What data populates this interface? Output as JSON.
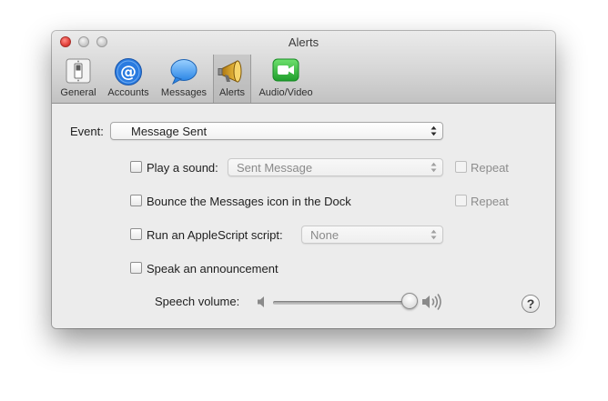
{
  "window": {
    "title": "Alerts"
  },
  "toolbar": {
    "tabs": [
      {
        "label": "General",
        "icon": "light-switch-icon",
        "selected": false
      },
      {
        "label": "Accounts",
        "icon": "at-sign-icon",
        "selected": false
      },
      {
        "label": "Messages",
        "icon": "speech-bubble-icon",
        "selected": false
      },
      {
        "label": "Alerts",
        "icon": "megaphone-icon",
        "selected": true
      },
      {
        "label": "Audio/Video",
        "icon": "video-camera-icon",
        "selected": false
      }
    ]
  },
  "event": {
    "label": "Event:",
    "selected": "Message Sent"
  },
  "options": {
    "play_sound": {
      "label": "Play a sound:",
      "checked": false,
      "value": "Sent Message",
      "repeat_label": "Repeat"
    },
    "bounce": {
      "label": "Bounce the Messages icon in the Dock",
      "checked": false,
      "repeat_label": "Repeat"
    },
    "applescript": {
      "label": "Run an AppleScript script:",
      "checked": false,
      "value": "None"
    },
    "speak": {
      "label": "Speak an announcement",
      "checked": false
    }
  },
  "speech_volume": {
    "label": "Speech volume:",
    "level": 1.0
  },
  "help": {
    "label": "?"
  },
  "colors": {
    "close": "#e2403a",
    "accounts_blue": "#2a7be0",
    "facetime_green": "#2fbe3c",
    "megaphone_gold": "#d9a11a"
  }
}
